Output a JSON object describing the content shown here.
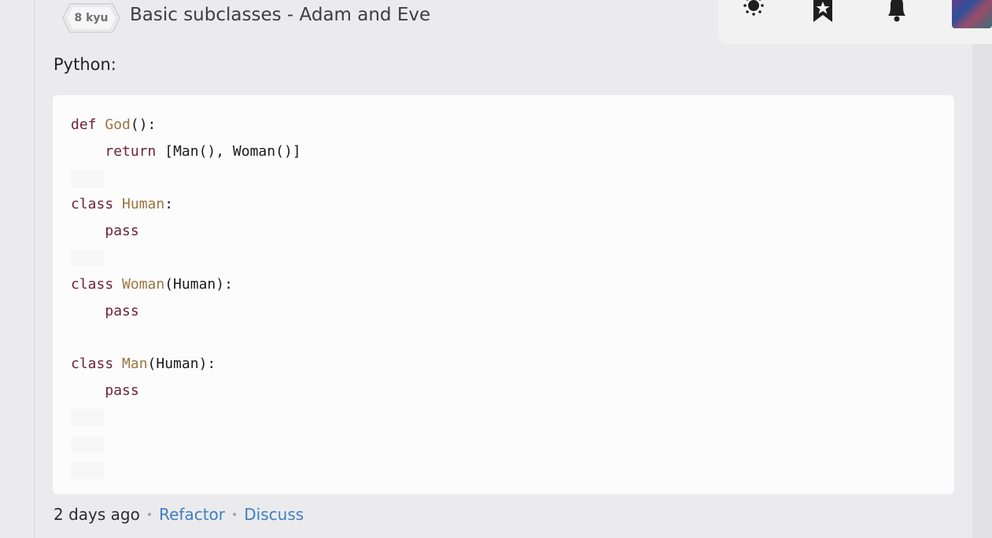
{
  "header": {
    "rank_label": "8 kyu",
    "kata_title": "Basic subclasses - Adam and Eve"
  },
  "solution": {
    "language_label": "Python:",
    "code_lines": [
      [
        {
          "t": "def",
          "c": "kw"
        },
        {
          "t": " "
        },
        {
          "t": "God",
          "c": "fn"
        },
        {
          "t": "():"
        }
      ],
      [
        {
          "t": "    "
        },
        {
          "t": "return",
          "c": "kw"
        },
        {
          "t": " [Man(), Woman()]"
        }
      ],
      [
        {
          "t": "",
          "blank": true
        }
      ],
      [
        {
          "t": "class",
          "c": "kw"
        },
        {
          "t": " "
        },
        {
          "t": "Human",
          "c": "fn"
        },
        {
          "t": ":"
        }
      ],
      [
        {
          "t": "    "
        },
        {
          "t": "pass",
          "c": "kw"
        }
      ],
      [
        {
          "t": "",
          "blank": true
        }
      ],
      [
        {
          "t": "class",
          "c": "kw"
        },
        {
          "t": " "
        },
        {
          "t": "Woman",
          "c": "fn"
        },
        {
          "t": "(Human):"
        }
      ],
      [
        {
          "t": "    "
        },
        {
          "t": "pass",
          "c": "kw"
        }
      ],
      [
        {
          "t": ""
        }
      ],
      [
        {
          "t": "class",
          "c": "kw"
        },
        {
          "t": " "
        },
        {
          "t": "Man",
          "c": "fn"
        },
        {
          "t": "(Human):"
        }
      ],
      [
        {
          "t": "    "
        },
        {
          "t": "pass",
          "c": "kw"
        }
      ],
      [
        {
          "t": "",
          "blank": true
        }
      ],
      [
        {
          "t": "",
          "blank": true
        }
      ],
      [
        {
          "t": "",
          "blank": true
        }
      ]
    ],
    "posted_ago": "2 days ago",
    "separator": "•",
    "refactor_label": "Refactor",
    "discuss_label": "Discuss"
  },
  "topbar": {
    "icons": [
      "theme-toggle-icon",
      "bookmark-star-icon",
      "notification-bell-icon",
      "user-avatar"
    ]
  },
  "colors": {
    "keyword": "#6f2338",
    "identifier": "#9a7640",
    "link": "#3e7ec2",
    "code_background": "#fcfcfc"
  }
}
